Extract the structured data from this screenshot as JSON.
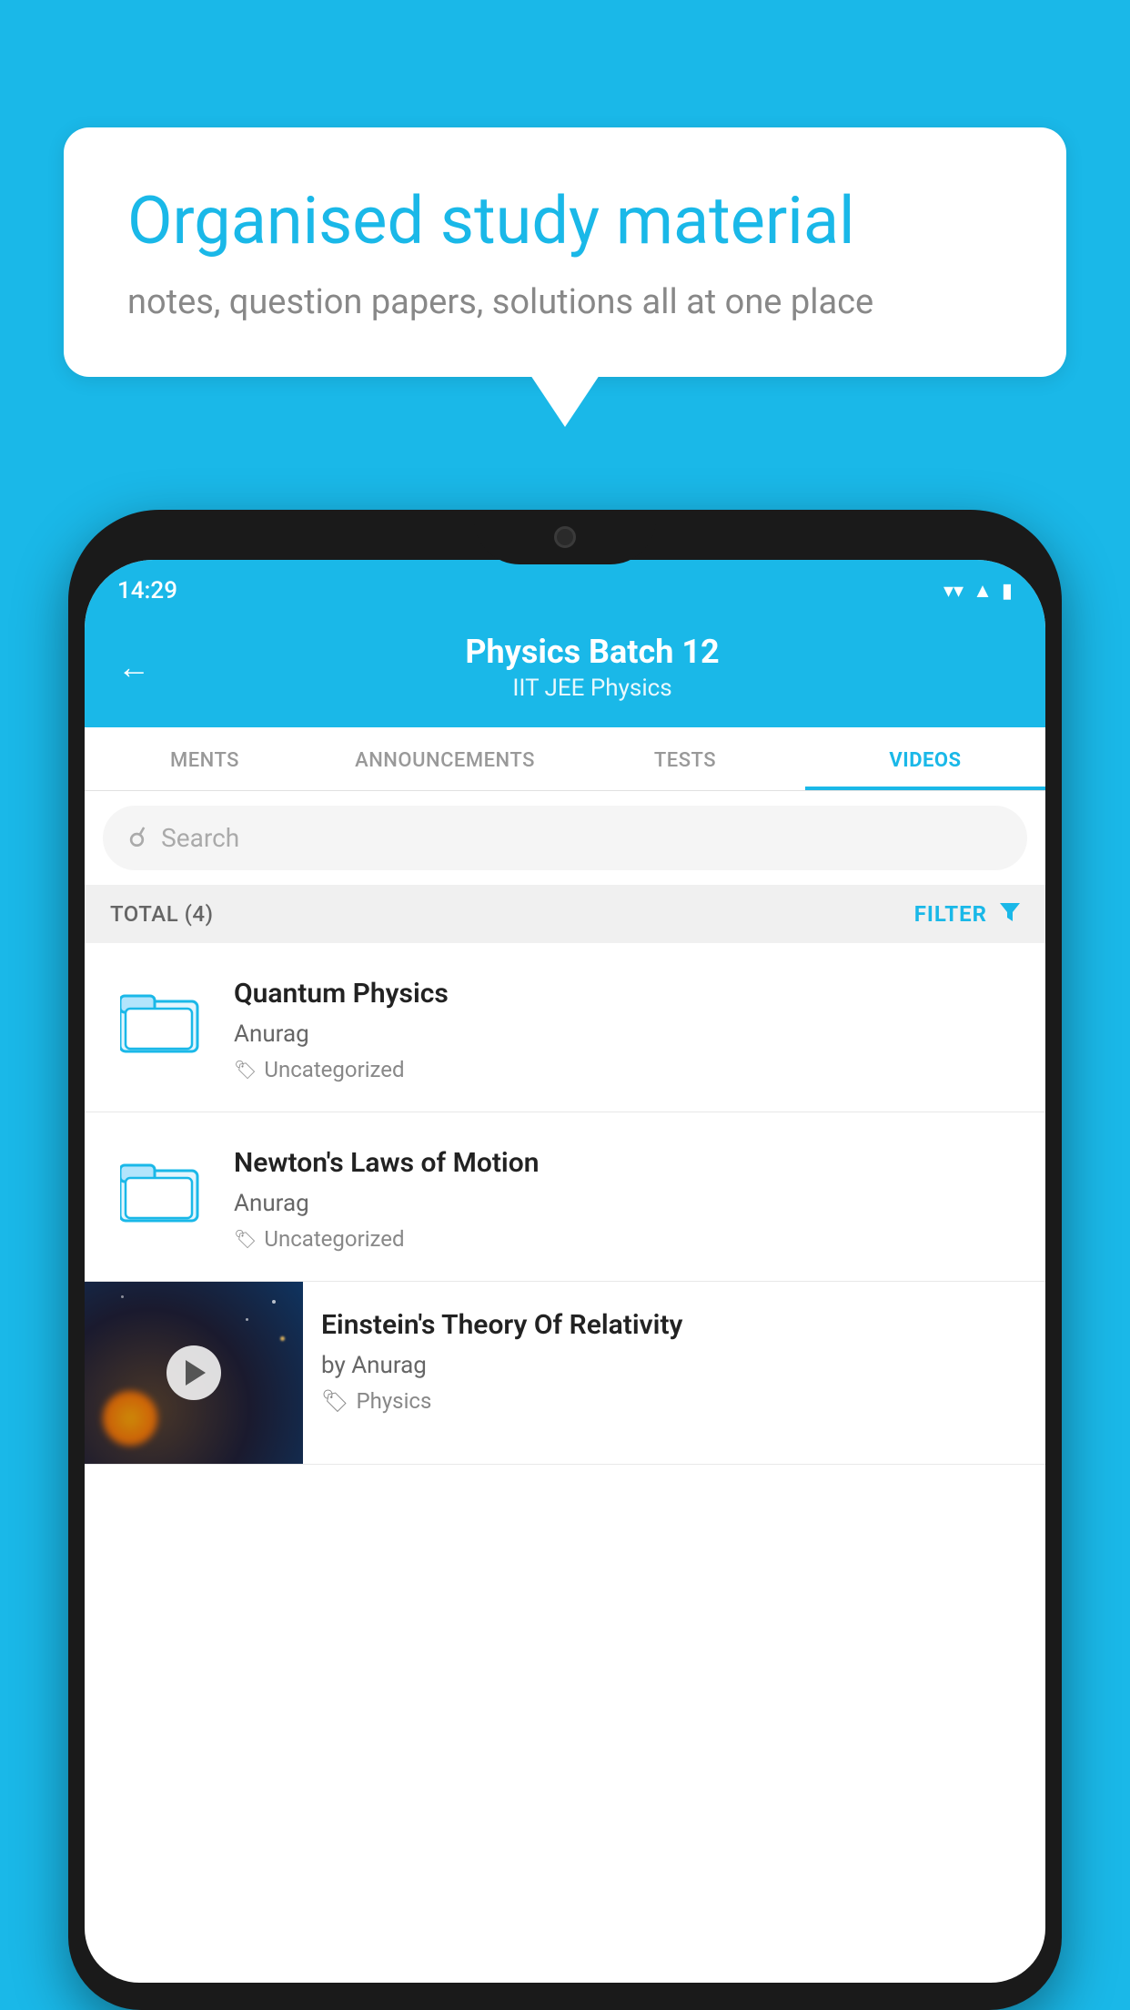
{
  "background": {
    "color": "#1ab8e8"
  },
  "speech_bubble": {
    "title": "Organised study material",
    "subtitle": "notes, question papers, solutions all at one place"
  },
  "status_bar": {
    "time": "14:29"
  },
  "app_header": {
    "title": "Physics Batch 12",
    "subtitle": "IIT JEE   Physics",
    "back_label": "←"
  },
  "tabs": [
    {
      "label": "MENTS",
      "active": false
    },
    {
      "label": "ANNOUNCEMENTS",
      "active": false
    },
    {
      "label": "TESTS",
      "active": false
    },
    {
      "label": "VIDEOS",
      "active": true
    }
  ],
  "search": {
    "placeholder": "Search"
  },
  "filter_bar": {
    "total": "TOTAL (4)",
    "filter_label": "FILTER"
  },
  "videos": [
    {
      "title": "Quantum Physics",
      "author": "Anurag",
      "tag": "Uncategorized",
      "type": "folder"
    },
    {
      "title": "Newton's Laws of Motion",
      "author": "Anurag",
      "tag": "Uncategorized",
      "type": "folder"
    },
    {
      "title": "Einstein's Theory Of Relativity",
      "author": "by Anurag",
      "tag": "Physics",
      "type": "video"
    }
  ]
}
